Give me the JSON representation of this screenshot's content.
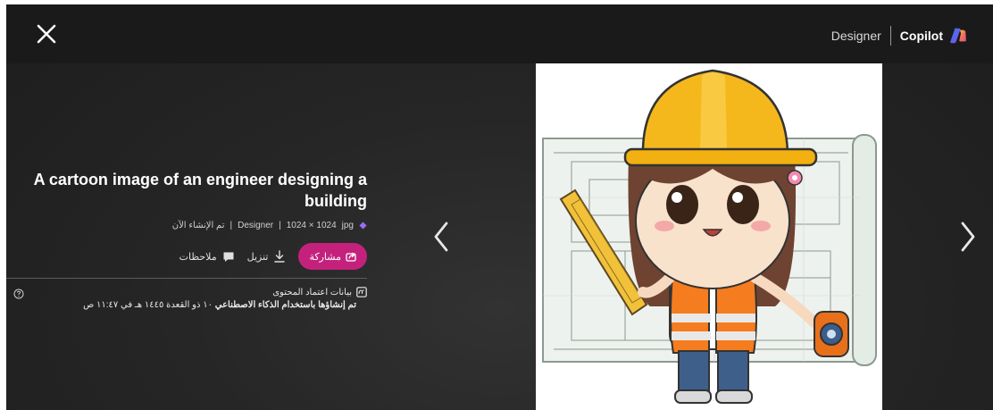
{
  "header": {
    "close_icon": "close-icon",
    "brand_designer": "Designer",
    "brand_copilot": "Copilot",
    "copilot_logo_icon": "copilot-logo-icon"
  },
  "details": {
    "title": "A cartoon image of an engineer designing a building",
    "meta": {
      "format": "jpg",
      "dimensions": "1024 × 1024",
      "source": "Designer",
      "created": "تم الإنشاء الآن"
    },
    "actions": {
      "share_label": "مشاركة",
      "download_label": "تنزيل",
      "feedback_label": "ملاحظات"
    },
    "credentials": {
      "label": "بيانات اعتماد المحتوى",
      "generated_bold": "تم إنشاؤها باستخدام الذكاء الاصطناعي",
      "generated_date": "١٠ ذو القعدة ١٤٤٥ هـ في ١١:٤٧ ص"
    }
  },
  "image": {
    "alt": "A cartoon image of an engineer designing a building"
  },
  "colors": {
    "accent": "#c4217d",
    "helmet": "#f5b81c",
    "vest": "#f57c1f"
  }
}
